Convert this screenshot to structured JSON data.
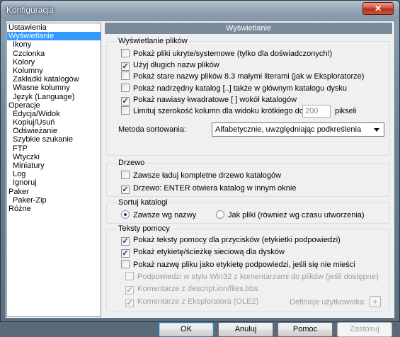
{
  "window": {
    "title": "Konfiguracja",
    "close_glyph": "✕"
  },
  "tree": [
    {
      "label": "Ustawienia",
      "level": 0
    },
    {
      "label": "Wyświetlanie",
      "level": 0,
      "selected": true
    },
    {
      "label": "Ikony",
      "level": 1
    },
    {
      "label": "Czcionka",
      "level": 1
    },
    {
      "label": "Kolory",
      "level": 1
    },
    {
      "label": "Kolumny",
      "level": 1
    },
    {
      "label": "Zakładki katalogów",
      "level": 1
    },
    {
      "label": "Własne kolumny",
      "level": 1
    },
    {
      "label": "Język (Language)",
      "level": 1
    },
    {
      "label": "Operacje",
      "level": 0
    },
    {
      "label": "Edycja/Widok",
      "level": 1
    },
    {
      "label": "Kopiuj/Usuń",
      "level": 1
    },
    {
      "label": "Odświeżanie",
      "level": 1
    },
    {
      "label": "Szybkie szukanie",
      "level": 1
    },
    {
      "label": "FTP",
      "level": 1
    },
    {
      "label": "Wtyczki",
      "level": 1
    },
    {
      "label": "Miniatury",
      "level": 1
    },
    {
      "label": "Log",
      "level": 1
    },
    {
      "label": "Ignoruj",
      "level": 1
    },
    {
      "label": "Paker",
      "level": 0
    },
    {
      "label": "Paker-Zip",
      "level": 1
    },
    {
      "label": "Różne",
      "level": 0
    }
  ],
  "panel": {
    "header": "Wyświetlanie"
  },
  "file_display": {
    "title": "Wyświetlanie plików",
    "options": [
      {
        "label": "Pokaż pliki ukryte/systemowe (tylko dla doświadczonych!)",
        "checked": false
      },
      {
        "label": "Użyj długich nazw plików",
        "checked": true
      },
      {
        "label": "Pokaż stare nazwy plików 8.3 małymi literami (jak w Eksploratorze)",
        "checked": false
      },
      {
        "label": "Pokaż nadrzędny katalog [..] także w głównym katalogu dysku",
        "checked": false
      },
      {
        "label": "Pokaż nawiasy kwadratowe [ ] wokół katalogów",
        "checked": true
      },
      {
        "label": "Limituj szerokość kolumn dla widoku krótkiego do:",
        "checked": false
      }
    ],
    "width_limit_value": "200",
    "width_limit_unit": "pikseli",
    "sort_label": "Metoda sortowania:",
    "sort_value": "Alfabetycznie, uwzględniając podkreślenia"
  },
  "tree_group": {
    "title": "Drzewo",
    "options": [
      {
        "label": "Zawsze ładuj kompletne drzewo katalogów",
        "checked": false
      },
      {
        "label": "Drzewo: ENTER otwiera katalog w innym oknie",
        "checked": true
      }
    ]
  },
  "sort_dirs": {
    "title": "Sortuj katalogi",
    "options": [
      {
        "label": "Zawsze wg nazwy",
        "selected": true
      },
      {
        "label": "Jak pliki (również wg czasu utworzenia)",
        "selected": false
      }
    ]
  },
  "tooltips": {
    "title": "Teksty pomocy",
    "options": [
      {
        "label": "Pokaż teksty pomocy dla przycisków (etykietki podpowiedzi)",
        "checked": true
      },
      {
        "label": "Pokaż etykietę/ścieżkę sieciową dla dysków",
        "checked": true
      },
      {
        "label": "Pokaż nazwę pliku jako etykietę podpowiedzi, jeśli się nie mieści",
        "checked": false
      },
      {
        "label": "Podpowiedzi w stylu Win32 z komentarzami do plików (jeśli dostępne)",
        "checked": false,
        "disabled": true
      },
      {
        "label": "Komentarze z descript.ion/files.bbs",
        "checked": true,
        "disabled": true
      },
      {
        "label": "Komentarze z Eksploratora (OLE2)",
        "checked": true,
        "disabled": true
      }
    ],
    "user_defs_label": "Definicje użytkownika:",
    "user_defs_button": "+"
  },
  "buttons": {
    "ok": "OK",
    "cancel": "Anuluj",
    "help": "Pomoc",
    "apply": "Zastosuj"
  }
}
